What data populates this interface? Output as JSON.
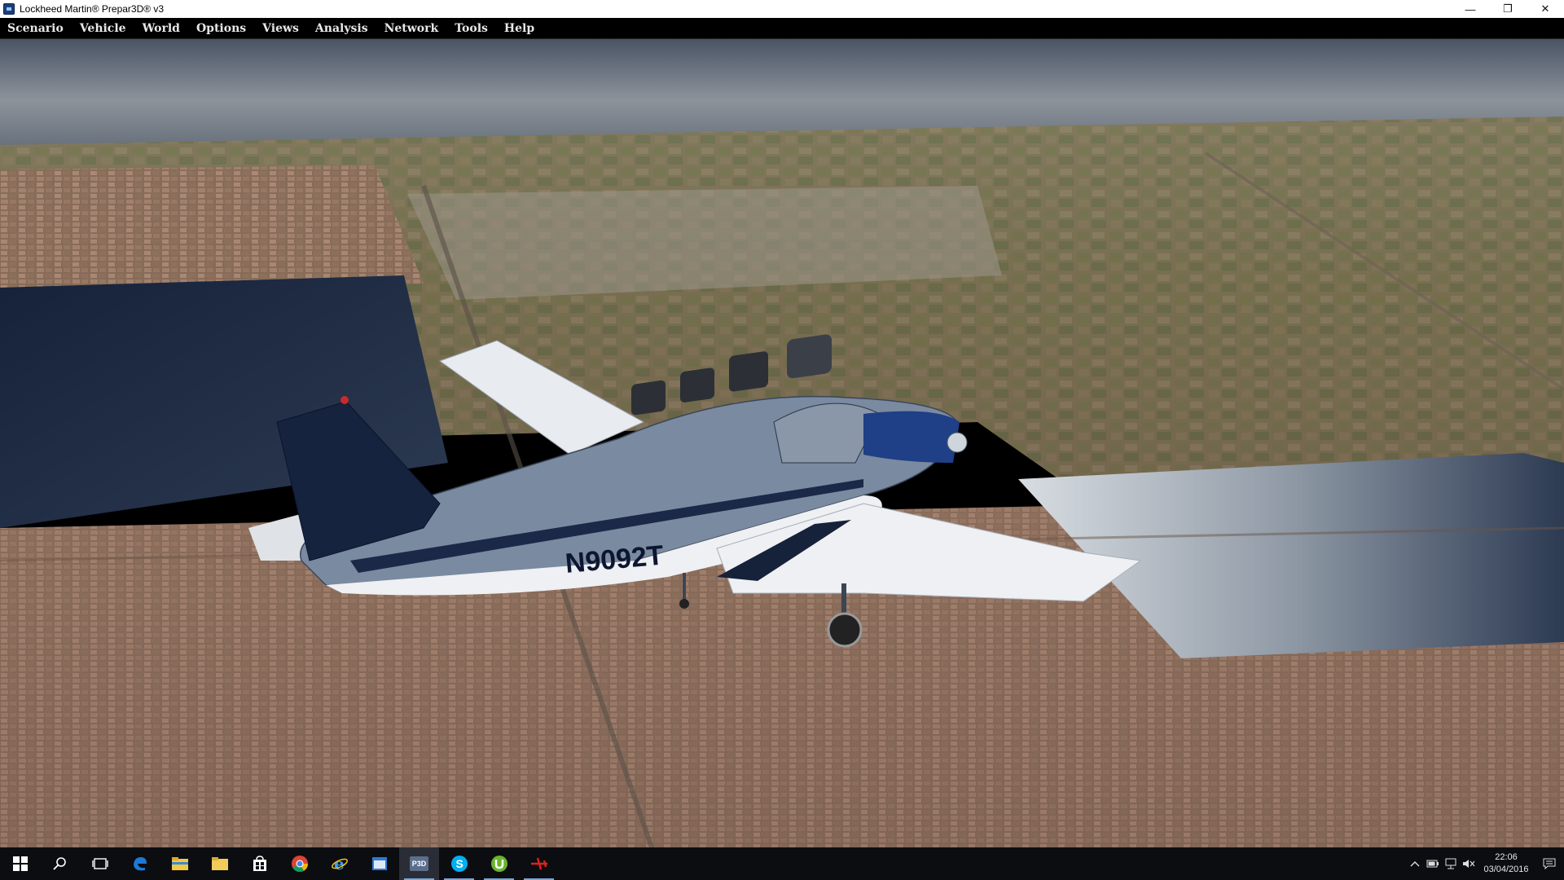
{
  "window": {
    "title": "Lockheed Martin® Prepar3D® v3",
    "controls": {
      "minimize": "—",
      "restore": "❐",
      "close": "✕"
    }
  },
  "menu": [
    {
      "label": "Scenario",
      "name": "menu-scenario"
    },
    {
      "label": "Vehicle",
      "name": "menu-vehicle"
    },
    {
      "label": "World",
      "name": "menu-world"
    },
    {
      "label": "Options",
      "name": "menu-options"
    },
    {
      "label": "Views",
      "name": "menu-views"
    },
    {
      "label": "Analysis",
      "name": "menu-analysis"
    },
    {
      "label": "Network",
      "name": "menu-network"
    },
    {
      "label": "Tools",
      "name": "menu-tools"
    },
    {
      "label": "Help",
      "name": "menu-help"
    }
  ],
  "aircraft": {
    "registration": "N9092T"
  },
  "taskbar": {
    "apps": [
      {
        "name": "start-button",
        "icon": "windows-logo-icon"
      },
      {
        "name": "search-button",
        "icon": "search-icon"
      },
      {
        "name": "task-view-button",
        "icon": "task-view-icon"
      },
      {
        "name": "edge-button",
        "icon": "edge-icon"
      },
      {
        "name": "file-explorer-button",
        "icon": "folder-icon"
      },
      {
        "name": "folder2-button",
        "icon": "folder-icon"
      },
      {
        "name": "store-button",
        "icon": "store-icon"
      },
      {
        "name": "chrome-button",
        "icon": "chrome-icon"
      },
      {
        "name": "ie-button",
        "icon": "ie-icon"
      },
      {
        "name": "app-window-button",
        "icon": "window-icon"
      },
      {
        "name": "p3d-button",
        "icon": "p3d-icon",
        "label": "P3D"
      },
      {
        "name": "skype-button",
        "icon": "skype-icon"
      },
      {
        "name": "utorrent-button",
        "icon": "utorrent-icon"
      },
      {
        "name": "red-plane-button",
        "icon": "plane-icon"
      }
    ],
    "clock": {
      "time": "22:06",
      "date": "03/04/2016"
    }
  },
  "colors": {
    "water": "#3d4a5e",
    "land": "#7b6f56",
    "city": "#8a6a5a",
    "fuselage": "#6f7f94",
    "tail": "#14233f"
  }
}
